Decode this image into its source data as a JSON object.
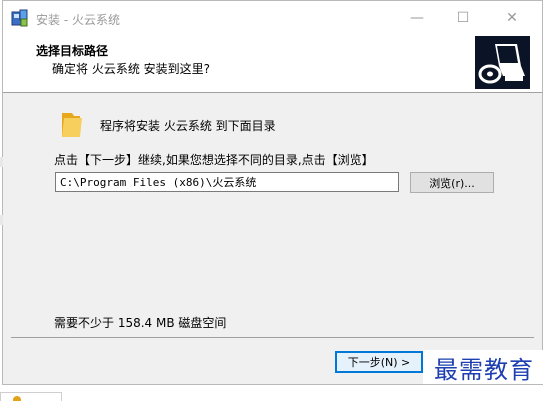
{
  "window": {
    "title": "安装 - 火云系统",
    "controls": {
      "minimize": "—",
      "maximize": "☐",
      "close": "✕"
    }
  },
  "header": {
    "title": "选择目标路径",
    "subtitle": "确定将 火云系统 安装到这里?"
  },
  "body": {
    "intro": "程序将安装 火云系统 到下面目录",
    "instruction": "点击【下一步】继续,如果您想选择不同的目录,点击【浏览】",
    "path_value": "C:\\Program Files (x86)\\火云系统",
    "browse_label": "浏览(r)...",
    "disk_space": "需要不少于 158.4 MB 磁盘空间"
  },
  "footer": {
    "next_label": "下一步(N) >",
    "watermark": "最需教育"
  },
  "colors": {
    "header_image_bg": "#0b1326",
    "next_border": "#0078d7",
    "watermark": "#1d3fb0",
    "folder": "#f4c430"
  },
  "icons": {
    "app": "installer-icon",
    "folder": "folder-icon",
    "header_image": "computer-cd-icon"
  }
}
